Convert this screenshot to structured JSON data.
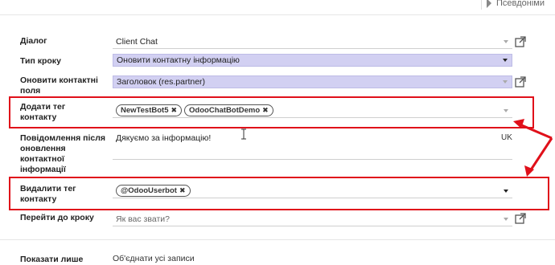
{
  "header": {
    "pseudo_label": "Псевдоніми"
  },
  "form": {
    "dialog": {
      "label": "Діалог",
      "value": "Client Chat"
    },
    "step_type": {
      "label": "Тип кроку",
      "value": "Оновити контактну інформацію"
    },
    "update_fields": {
      "label": "Оновити контактні поля",
      "value": "Заголовок (res.partner)"
    },
    "add_tag": {
      "label": "Додати тег контакту",
      "tags": [
        "NewTestBot5",
        "OdooChatBotDemo"
      ]
    },
    "message": {
      "label": "Повідомлення після оновлення контактної інформації",
      "value": "Дякуємо за інформацію!",
      "lang": "UK"
    },
    "remove_tag": {
      "label": "Видалити тег контакту",
      "tags": [
        "@OdooUserbot"
      ]
    },
    "goto_step": {
      "label": "Перейти до кроку",
      "placeholder": "Як вас звати?"
    },
    "show_only": {
      "label": "Показати лише",
      "value": "Об'єднати усі записи"
    }
  },
  "icons": {
    "external": "external-link-icon",
    "tag_remove": "close-icon"
  },
  "colors": {
    "highlight": "#d2d0f2",
    "annotation": "#e0101a"
  }
}
